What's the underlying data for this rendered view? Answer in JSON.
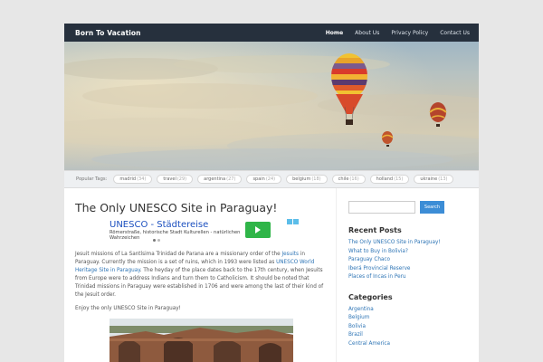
{
  "site": {
    "title": "Born To Vacation"
  },
  "nav": {
    "items": [
      "Home",
      "About Us",
      "Privacy Policy",
      "Contact Us"
    ]
  },
  "tags": {
    "label": "Popular Tags:",
    "items": [
      {
        "name": "madrid",
        "count": "(34)"
      },
      {
        "name": "travel",
        "count": "(29)"
      },
      {
        "name": "argentina",
        "count": "(27)"
      },
      {
        "name": "spain",
        "count": "(24)"
      },
      {
        "name": "belgium",
        "count": "(18)"
      },
      {
        "name": "chile",
        "count": "(16)"
      },
      {
        "name": "holland",
        "count": "(15)"
      },
      {
        "name": "ukraine",
        "count": "(13)"
      }
    ]
  },
  "post": {
    "title": "The Only UNESCO Site in Paraguay!",
    "ad": {
      "title": "UNESCO - Städtereise",
      "subtitle": "Römerstraße, historische Stadt Kulturellen - natürlichen Wahrzeichen"
    },
    "p1a": "Jesuit missions of La Santísima Trinidad de Parana are a missionary order of the ",
    "p1link1": "Jesuits",
    "p1b": " in Paraguay. Currently the mission is a set of ruins, which in 1993 were listed as ",
    "p1link2": "UNESCO World Heritage Site in Paraguay",
    "p1c": ". The heyday of the place dates back to the 17th century, when Jesuits from Europe were to address Indians and turn them to Catholicism. It should be noted that Trinidad missions in Paraguay were established in 1706 and were among the last of their kind of the Jesuit order.",
    "p2": "Enjoy the only UNESCO Site in Paraguay!"
  },
  "sidebar": {
    "search_button": "Search",
    "recent_title": "Recent Posts",
    "recent": [
      "The Only UNESCO Site in Paraguay!",
      "What to Buy in Bolivia?",
      "Paraguay Chaco",
      "Iberá Provincial Reserve",
      "Places of Incas in Peru"
    ],
    "categories_title": "Categories",
    "categories": [
      "Argentina",
      "Belgium",
      "Bolivia",
      "Brazil",
      "Central America"
    ]
  }
}
